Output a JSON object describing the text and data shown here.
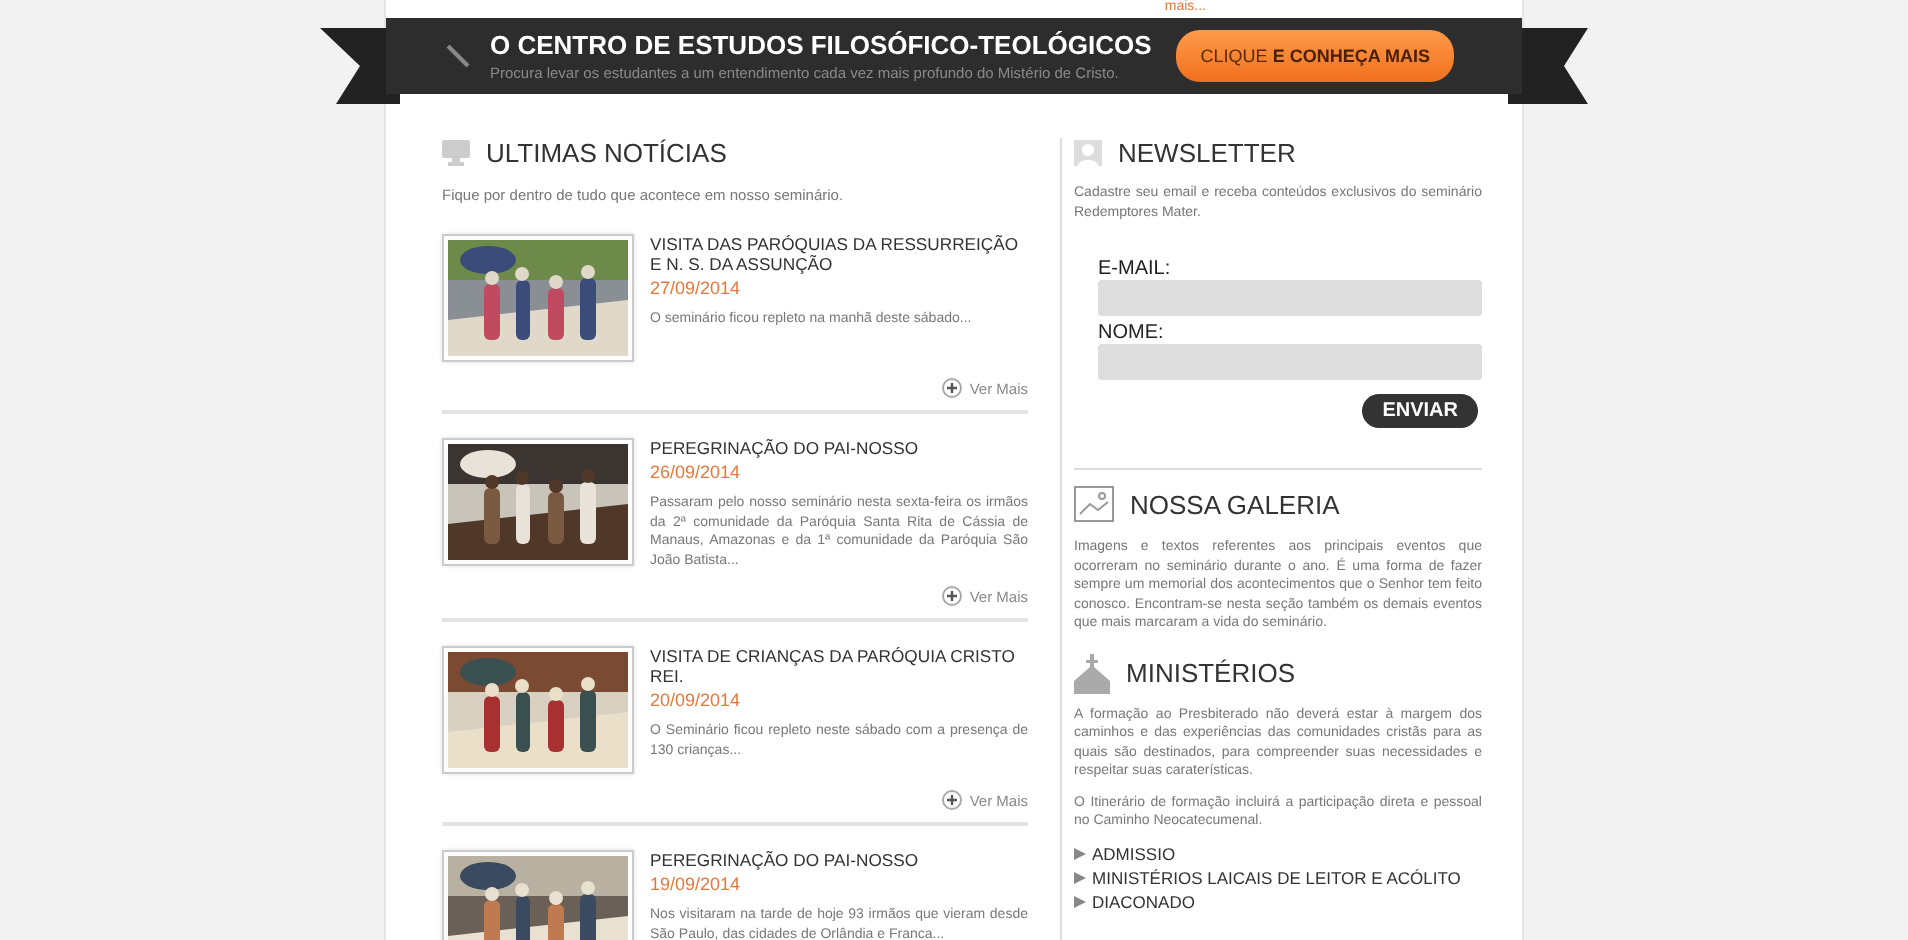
{
  "top_link": "mais...",
  "banner": {
    "title": "O CENTRO DE ESTUDOS FILOSÓFICO-TEOLÓGICOS",
    "subtitle": "Procura levar os estudantes a um entendimento cada vez mais profundo do Mistério de Cristo.",
    "button_plain": "CLIQUE",
    "button_bold": "E CONHEÇA MAIS"
  },
  "news": {
    "title": "ULTIMAS NOTÍCIAS",
    "intro": "Fique por dentro de tudo que acontece em nosso seminário.",
    "items": [
      {
        "title": "VISITA DAS PARÓQUIAS DA RESSURREIÇÃO E N. S. DA ASSUNÇÃO",
        "date": "27/09/2014",
        "summary": "O seminário ficou repleto na manhã deste sábado...",
        "more": "Ver Mais"
      },
      {
        "title": "PEREGRINAÇÃO DO PAI-NOSSO",
        "date": "26/09/2014",
        "summary": "Passaram pelo nosso seminário nesta sexta-feira os irmãos da 2ª comunidade da Paróquia Santa Rita de Cássia de Manaus, Amazonas e da 1ª comunidade da Paróquia São João Batista...",
        "more": "Ver Mais"
      },
      {
        "title": "VISITA DE CRIANÇAS DA PARÓQUIA CRISTO REI.",
        "date": "20/09/2014",
        "summary": "O Seminário ficou repleto neste sábado com a presença de 130 crianças...",
        "more": "Ver Mais"
      },
      {
        "title": "PEREGRINAÇÃO DO PAI-NOSSO",
        "date": "19/09/2014",
        "summary": "Nos visitaram na tarde de hoje 93 irmãos que vieram desde São Paulo, das cidades de Orlândia e Franca..."
      }
    ]
  },
  "newsletter": {
    "title": "NEWSLETTER",
    "intro": "Cadastre seu email e receba conteúdos exclusivos do seminário Redemptores Mater.",
    "fields": [
      {
        "label": "E-MAIL:"
      },
      {
        "label": "NOME:"
      }
    ],
    "button": "ENVIAR"
  },
  "gallery": {
    "title": "NOSSA GALERIA",
    "text": "Imagens e textos referentes aos principais eventos que ocorreram no seminário durante o ano. É uma forma de fazer sempre um memorial dos acontecimentos que o Senhor tem feito conosco. Encontram-se nesta seção também os demais eventos que mais marcaram a vida do seminário."
  },
  "ministries": {
    "title": "MINISTÉRIOS",
    "paragraphs": [
      "A formação ao Presbiterado não deverá estar à margem dos caminhos e das experiências das comunidades cristãs para as quais são destinados, para compreender suas necessidades e respeitar suas caraterísticas.",
      "O Itinerário de formação incluirá a participação direta e pessoal no Caminho Neocatecumenal."
    ],
    "links": [
      "ADMISSIO",
      "MINISTÉRIOS LAICAIS DE LEITOR E ACÓLITO",
      "DIACONADO"
    ]
  }
}
